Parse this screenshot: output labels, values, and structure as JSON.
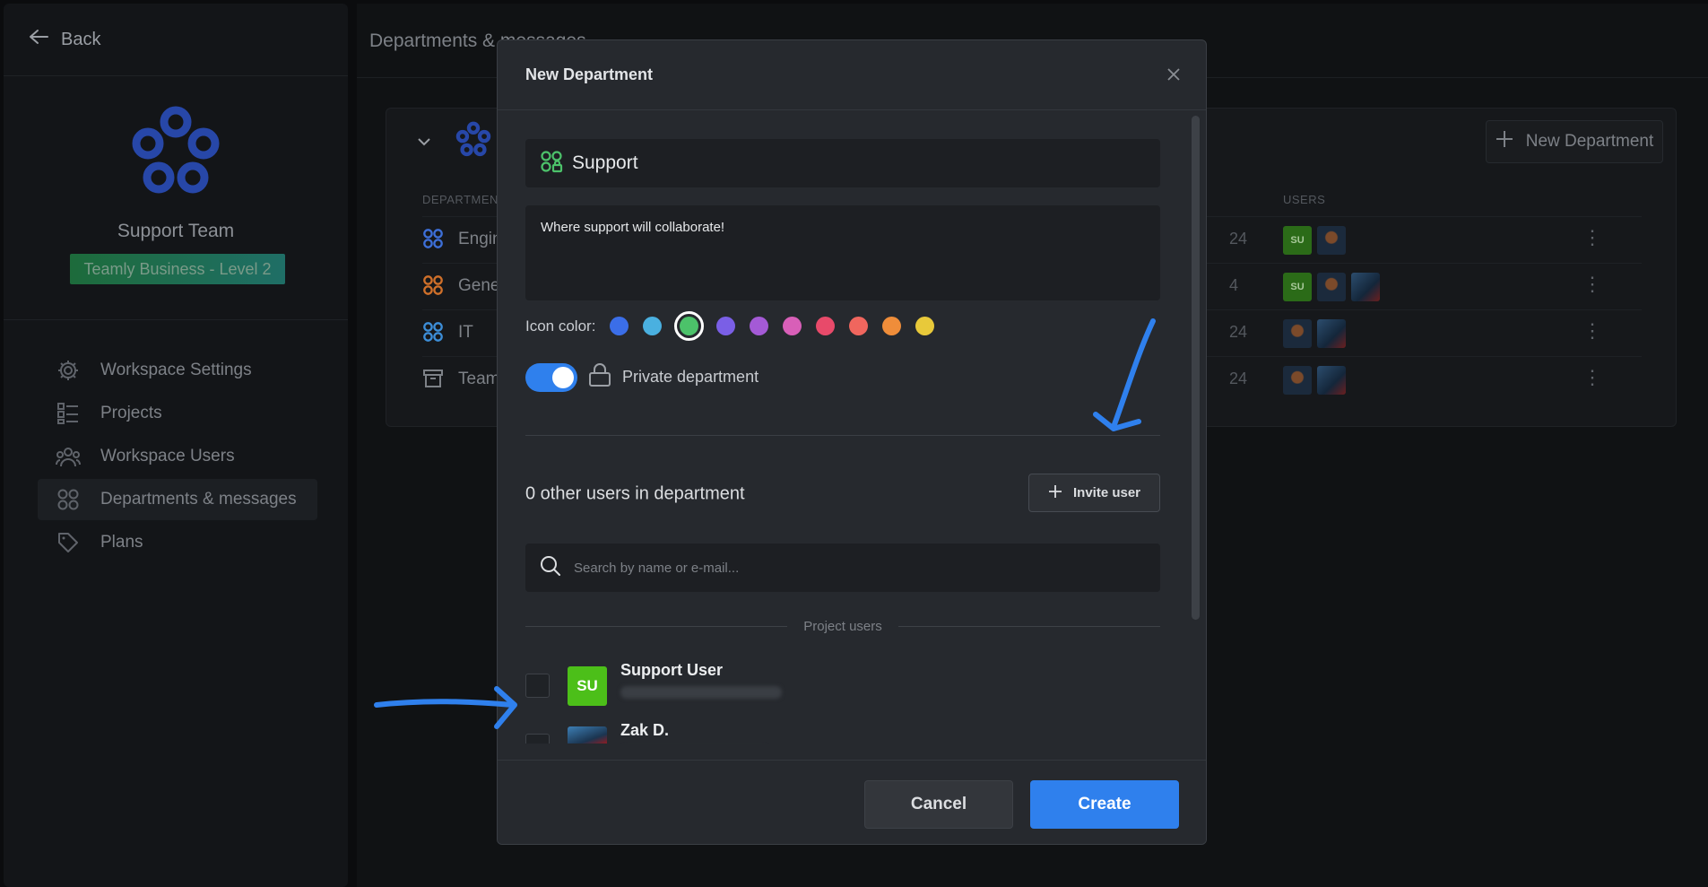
{
  "sidebar": {
    "back_label": "Back",
    "workspace_name": "Support Team",
    "plan_badge": "Teamly Business - Level 2",
    "items": [
      {
        "label": "Workspace Settings",
        "icon": "gear-icon"
      },
      {
        "label": "Projects",
        "icon": "projects-icon"
      },
      {
        "label": "Workspace Users",
        "icon": "users-icon"
      },
      {
        "label": "Departments & messages",
        "icon": "departments-icon",
        "active": true
      },
      {
        "label": "Plans",
        "icon": "tag-icon"
      }
    ]
  },
  "main": {
    "title": "Departments & messages",
    "new_department_label": "New Department",
    "columns": {
      "department": "DEPARTMENT",
      "users": "USERS"
    },
    "departments": [
      {
        "name": "Engin",
        "date": "24",
        "color": "#3d6fd8",
        "users": [
          "SU",
          "img1"
        ]
      },
      {
        "name": "Gene",
        "date": "4",
        "color": "#d0702a",
        "users": [
          "SU",
          "img1",
          "img2"
        ]
      },
      {
        "name": "IT",
        "date": "24",
        "color": "#3d8ed8",
        "users": [
          "img1",
          "img2"
        ]
      },
      {
        "name": "Team",
        "date": "24",
        "color": "#7d8187",
        "users": [
          "img1",
          "img2"
        ]
      }
    ]
  },
  "modal": {
    "title": "New Department",
    "name_value": "Support",
    "description_value": "Where support will collaborate!",
    "icon_color_label": "Icon color:",
    "colors": [
      "#3b6ee8",
      "#4ab0e0",
      "#4cc26a",
      "#7a5fe6",
      "#a45ad6",
      "#d85fb8",
      "#e84a6a",
      "#f0665e",
      "#ef8d3a",
      "#e8c93a"
    ],
    "selected_color": "#4cc26a",
    "private_label": "Private department",
    "private_enabled": true,
    "users_count_text": "0 other users in department",
    "invite_label": "Invite user",
    "search_placeholder": "Search by name or e-mail...",
    "group_label": "Project users",
    "users": [
      {
        "name": "Support User",
        "avatar_text": "SU",
        "avatar_color": "#4cbf19"
      },
      {
        "name": "Zak D.",
        "avatar_text": ""
      }
    ],
    "cancel_label": "Cancel",
    "create_label": "Create"
  }
}
